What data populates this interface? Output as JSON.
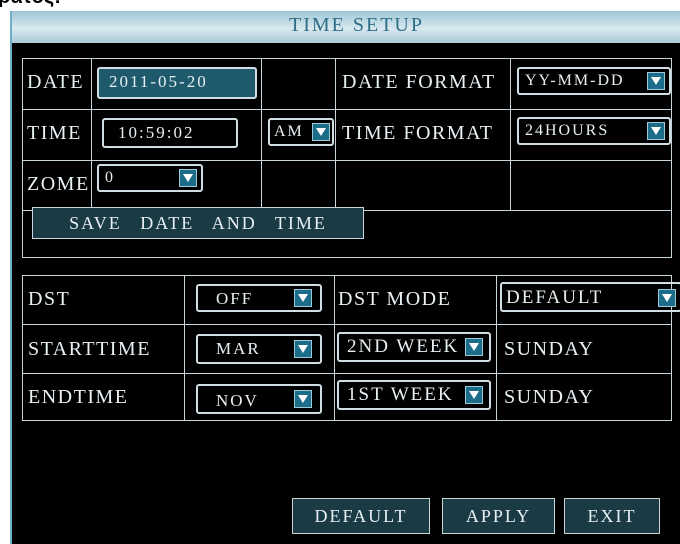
{
  "fragment_text": "ρατός:",
  "window": {
    "title": "TIME SETUP"
  },
  "date": {
    "label": "DATE",
    "value": "2011-05-20"
  },
  "time": {
    "label": "TIME",
    "value": "10:59:02",
    "ampm": "AM"
  },
  "zone": {
    "label": "ZOME",
    "value": "0"
  },
  "date_format": {
    "label": "DATE FORMAT",
    "value": "YY-MM-DD"
  },
  "time_format": {
    "label": "TIME FORMAT",
    "value": "24HOURS"
  },
  "save_button": "SAVE DATE AND TIME",
  "dst": {
    "label": "DST",
    "value": "OFF",
    "mode_label": "DST MODE",
    "mode_value": "DEFAULT"
  },
  "start": {
    "label": "STARTTIME",
    "month": "MAR",
    "week": "2ND WEEK",
    "day": "SUNDAY"
  },
  "end": {
    "label": "ENDTIME",
    "month": "NOV",
    "week": "1ST WEEK",
    "day": "SUNDAY"
  },
  "buttons": {
    "default": "DEFAULT",
    "apply": "APPLY",
    "exit": "EXIT"
  },
  "colors": {
    "window_bg": "#000000",
    "title_bar": "#b9d6e1",
    "accent": "#1b6d8a",
    "selected_field": "#1f5a6c"
  },
  "icons": {
    "dropdown": "chevron-down-icon"
  }
}
